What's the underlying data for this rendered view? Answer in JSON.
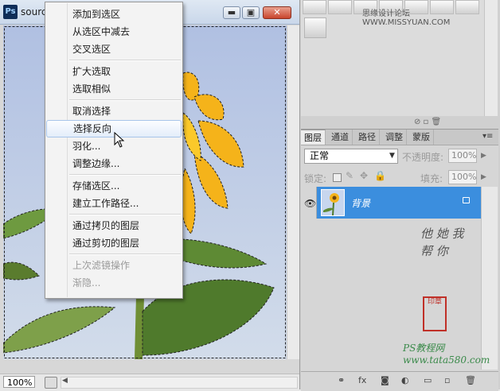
{
  "document": {
    "title": "source",
    "ps_badge": "Ps",
    "window_buttons": {
      "minimize": "▬",
      "restore": "▣",
      "close": "✕"
    },
    "zoom": "100%"
  },
  "context_menu": {
    "groups": [
      [
        {
          "label": "添加到选区"
        },
        {
          "label": "从选区中减去"
        },
        {
          "label": "交叉选区"
        }
      ],
      [
        {
          "label": "扩大选取"
        },
        {
          "label": "选取相似"
        }
      ],
      [
        {
          "label": "取消选择"
        },
        {
          "label": "选择反向",
          "hover": true
        },
        {
          "label": "羽化..."
        },
        {
          "label": "调整边缘..."
        }
      ],
      [
        {
          "label": "存储选区..."
        },
        {
          "label": "建立工作路径..."
        }
      ],
      [
        {
          "label": "通过拷贝的图层"
        },
        {
          "label": "通过剪切的图层"
        }
      ],
      [
        {
          "label": "上次滤镜操作",
          "disabled": true
        },
        {
          "label": "渐隐...",
          "disabled": true
        }
      ]
    ]
  },
  "swatches": {
    "watermark": "思缘设计论坛 WWW.MISSYUAN.COM"
  },
  "layers_panel": {
    "tabs": [
      "图层",
      "通道",
      "路径",
      "调整",
      "蒙版"
    ],
    "active_tab": "图层",
    "blend_mode": "正常",
    "opacity_label": "不透明度:",
    "opacity_value": "100%",
    "lock_label": "锁定:",
    "fill_label": "填充:",
    "fill_value": "100%",
    "layer": {
      "name": "背景",
      "locked": true,
      "visible": true
    },
    "calligraphy": "他 她 我 帮 你",
    "seal_text": "印章",
    "bottom_watermark": "PS教程网 www.tata580.com"
  },
  "colors": {
    "selection_blue": "#3b8ede",
    "petal": "#f5b31a",
    "leaf": "#4f7a2c",
    "sky": "#b7c4da"
  }
}
